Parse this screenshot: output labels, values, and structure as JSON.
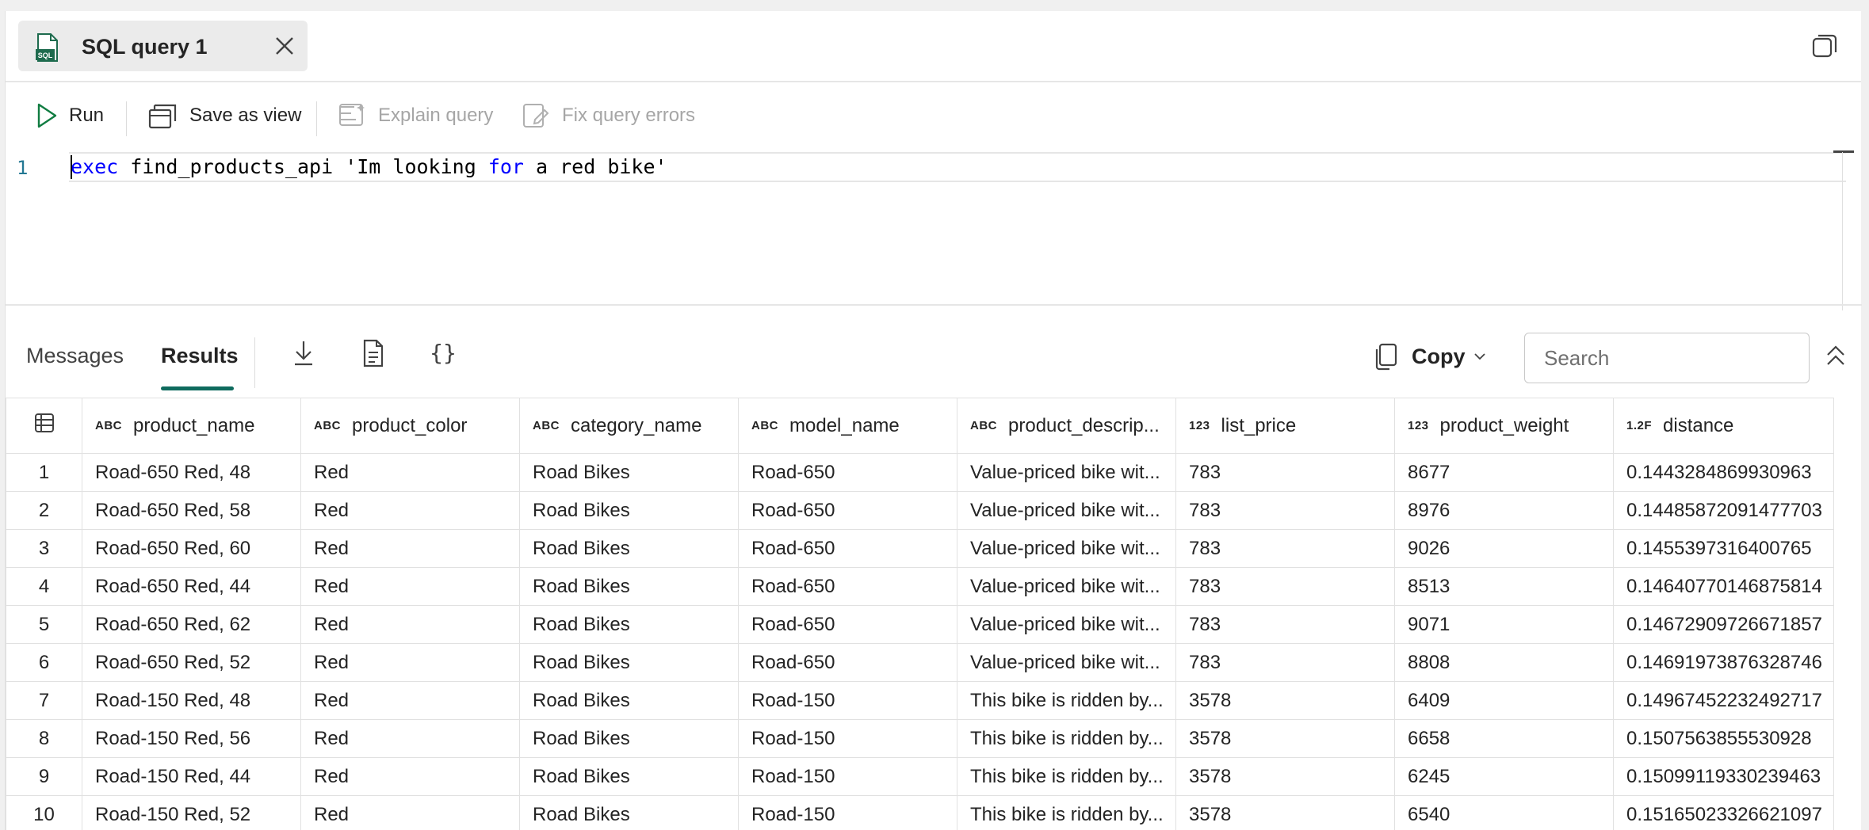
{
  "tab": {
    "title": "SQL query 1",
    "icon_text": "SQL"
  },
  "toolbar": {
    "run": "Run",
    "save_as_view": "Save as view",
    "explain_query": "Explain query",
    "fix_query_errors": "Fix query errors"
  },
  "editor": {
    "line_number": "1",
    "code_kw1": "exec",
    "code_mid": " find_products_api 'Im looking ",
    "code_kw2": "for",
    "code_end": " a red bike'"
  },
  "results": {
    "tabs": {
      "messages": "Messages",
      "results": "Results"
    },
    "json_icon_text": "{}",
    "copy_label": "Copy",
    "search_placeholder": "Search",
    "columns": [
      {
        "type": "ABC",
        "name": "product_name"
      },
      {
        "type": "ABC",
        "name": "product_color"
      },
      {
        "type": "ABC",
        "name": "category_name"
      },
      {
        "type": "ABC",
        "name": "model_name"
      },
      {
        "type": "ABC",
        "name": "product_descrip..."
      },
      {
        "type": "123",
        "name": "list_price"
      },
      {
        "type": "123",
        "name": "product_weight"
      },
      {
        "type": "1.2F",
        "name": "distance"
      }
    ],
    "rows": [
      [
        "1",
        "Road-650 Red, 48",
        "Red",
        "Road Bikes",
        "Road-650",
        "Value-priced bike wit...",
        "783",
        "8677",
        "0.1443284869930963"
      ],
      [
        "2",
        "Road-650 Red, 58",
        "Red",
        "Road Bikes",
        "Road-650",
        "Value-priced bike wit...",
        "783",
        "8976",
        "0.14485872091477703"
      ],
      [
        "3",
        "Road-650 Red, 60",
        "Red",
        "Road Bikes",
        "Road-650",
        "Value-priced bike wit...",
        "783",
        "9026",
        "0.1455397316400765"
      ],
      [
        "4",
        "Road-650 Red, 44",
        "Red",
        "Road Bikes",
        "Road-650",
        "Value-priced bike wit...",
        "783",
        "8513",
        "0.14640770146875814"
      ],
      [
        "5",
        "Road-650 Red, 62",
        "Red",
        "Road Bikes",
        "Road-650",
        "Value-priced bike wit...",
        "783",
        "9071",
        "0.14672909726671857"
      ],
      [
        "6",
        "Road-650 Red, 52",
        "Red",
        "Road Bikes",
        "Road-650",
        "Value-priced bike wit...",
        "783",
        "8808",
        "0.14691973876328746"
      ],
      [
        "7",
        "Road-150 Red, 48",
        "Red",
        "Road Bikes",
        "Road-150",
        "This bike is ridden by...",
        "3578",
        "6409",
        "0.14967452232492717"
      ],
      [
        "8",
        "Road-150 Red, 56",
        "Red",
        "Road Bikes",
        "Road-150",
        "This bike is ridden by...",
        "3578",
        "6658",
        "0.1507563855530928"
      ],
      [
        "9",
        "Road-150 Red, 44",
        "Red",
        "Road Bikes",
        "Road-150",
        "This bike is ridden by...",
        "3578",
        "6245",
        "0.15099119330239463"
      ],
      [
        "10",
        "Road-150 Red, 52",
        "Red",
        "Road Bikes",
        "Road-150",
        "This bike is ridden by...",
        "3578",
        "6540",
        "0.15165023326621097"
      ]
    ]
  },
  "colors": {
    "accent": "#0f6b5e",
    "keyword": "#0000ff",
    "line_number": "#237893"
  }
}
